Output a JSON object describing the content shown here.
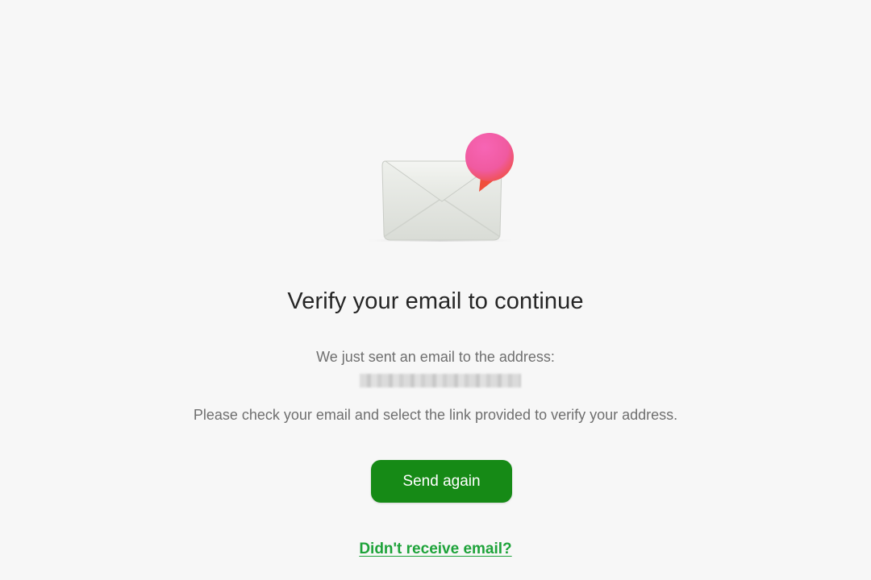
{
  "verification": {
    "title": "Verify your email to continue",
    "sent_message": "We just sent an email to the address:",
    "instructions": "Please check your email and select the link provided to verify your address.",
    "send_again_label": "Send again",
    "help_link_label": "Didn't receive email?"
  },
  "icons": {
    "illustration": "envelope-notification-icon"
  },
  "colors": {
    "primary_button": "#168a16",
    "link": "#1ea33a",
    "notification_bubble": "#f25aa6"
  }
}
